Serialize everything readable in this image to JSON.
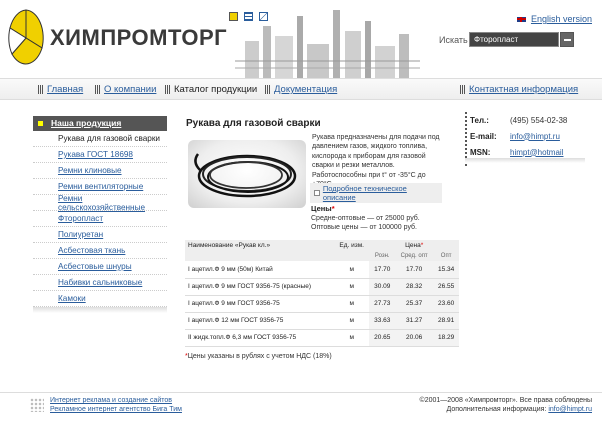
{
  "header": {
    "logo_text": "ХИМПРОМТОРГ",
    "english_link": "English version",
    "search_label": "Искать",
    "search_value": "Фторопласт",
    "colors": {
      "logo_yellow": "#f0d000",
      "accent_link": "#2a5d9c"
    }
  },
  "top_icons": [
    "home-icon",
    "sitemap-icon",
    "mail-icon"
  ],
  "nav": {
    "items": [
      {
        "label": "Главная"
      },
      {
        "label": "О компании"
      },
      {
        "label": "Каталог продукции"
      },
      {
        "label": "Документация"
      },
      {
        "label": "Контактная информация"
      }
    ]
  },
  "sidebar": {
    "heading": "Наша продукция",
    "items": [
      {
        "label": "Рукава для газовой сварки"
      },
      {
        "label": "Рукава ГОСТ 18698"
      },
      {
        "label": "Ремни клиновые"
      },
      {
        "label": "Ремни вентиляторные"
      },
      {
        "label": "Ремни сельскохозяйственные"
      },
      {
        "label": "Фторопласт"
      },
      {
        "label": "Полиуретан"
      },
      {
        "label": "Асбестовая ткань"
      },
      {
        "label": "Асбестовые шнуры"
      },
      {
        "label": "Набивки сальниковые"
      },
      {
        "label": "Камоки"
      }
    ]
  },
  "main": {
    "title": "Рукава для газовой сварки",
    "description": "Рукава предназначены для подачи под давлением газов, жидкого топлива, кислорода к приборам для газовой сварки и резки металлов. Работоспособны при t° от -35°С до +70°С.",
    "tech_link": "Подробное техническое описание",
    "prices_heading": "Цены",
    "star": "*",
    "price_wholesale": "Средне-оптовые — от 25000 руб.",
    "price_bulk": "Оптовые цены — от 100000 руб.",
    "footnote": "Цены указаны в рублях с учетом НДС (18%)"
  },
  "table": {
    "col_name": "Наименование «Рукав кл.»",
    "col_unit": "Ед. изм.",
    "col_price": "Цена",
    "sub_retail": "Розн.",
    "sub_mid": "Сред. опт",
    "sub_opt": "Опт",
    "rows": [
      {
        "name": "I ацетил.Ф 9 мм (50м) Китай",
        "unit": "м",
        "retail": "17.70",
        "mid": "17.70",
        "opt": "15.34"
      },
      {
        "name": "I ацетил.Ф 9 мм ГОСТ 9356-75 (красные)",
        "unit": "м",
        "retail": "30.09",
        "mid": "28.32",
        "opt": "26.55"
      },
      {
        "name": "I ацетил.Ф 9 мм ГОСТ 9356-75",
        "unit": "м",
        "retail": "27.73",
        "mid": "25.37",
        "opt": "23.60"
      },
      {
        "name": "I ацетил.Ф 12 мм ГОСТ 9356-75",
        "unit": "м",
        "retail": "33.63",
        "mid": "31.27",
        "opt": "28.91"
      },
      {
        "name": "II жидк.топл.Ф 6,3 мм ГОСТ 9356-75",
        "unit": "м",
        "retail": "20.65",
        "mid": "20.06",
        "opt": "18.29"
      }
    ]
  },
  "contacts": {
    "tel_label": "Тел.:",
    "tel_value": "(495) 554-02-38",
    "email_label": "E-mail:",
    "email_value": "info@himpt.ru",
    "msn_label": "MSN:",
    "msn_value": "himpt@hotmail"
  },
  "footer": {
    "link1": "Интернет реклама и создание сайтов",
    "link2": "Рекламное интернет агентство Бига Тим",
    "copyright": "©2001—2008 «Химпромторг». Все права соблюдены",
    "info_label": "Дополнительная информация:",
    "info_email": "info@himpt.ru"
  }
}
